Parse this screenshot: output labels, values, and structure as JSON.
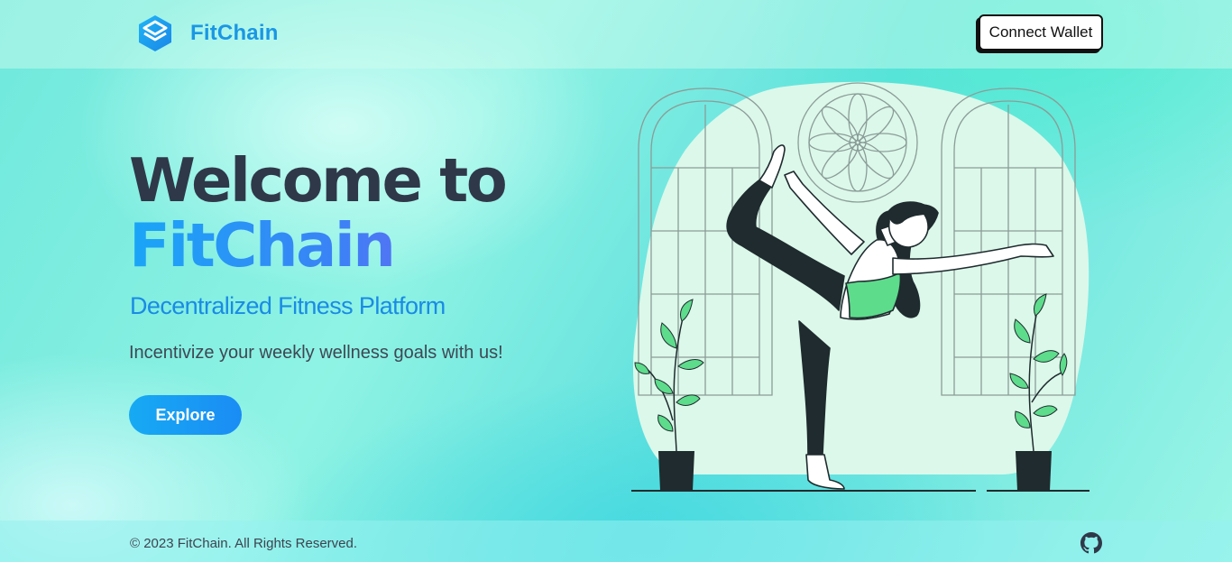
{
  "header": {
    "brand_name": "FitChain",
    "logo_icon": "cube-logo-icon",
    "connect_wallet_label": "Connect Wallet"
  },
  "hero": {
    "title_line1": "Welcome to",
    "title_brand": "FitChain",
    "subtitle": "Decentralized Fitness Platform",
    "tagline": "Incentivize your weekly wellness goals with us!",
    "explore_label": "Explore",
    "illustration": "yoga-pose-illustration"
  },
  "footer": {
    "copyright": "© 2023 FitChain. All Rights Reserved.",
    "github_icon": "github-icon"
  },
  "colors": {
    "brand_blue": "#1a97e4",
    "title_dark": "#2f3849",
    "gradient_start": "#19a6f7",
    "gradient_end": "#7b5cf1",
    "accent_green": "#5ddc8c"
  }
}
